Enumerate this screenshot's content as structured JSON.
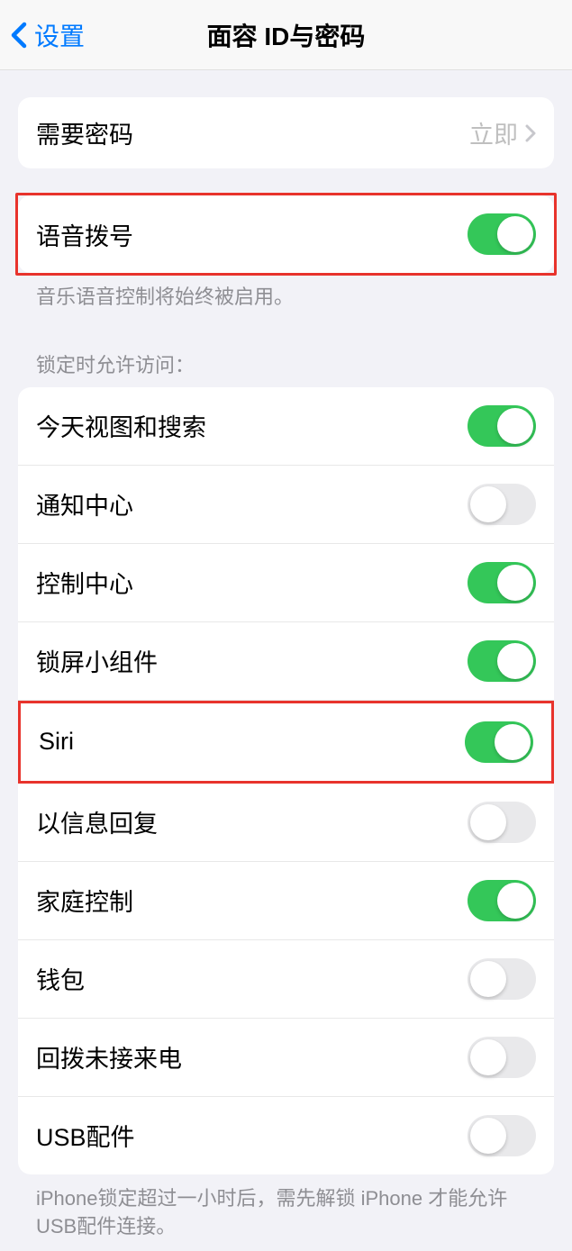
{
  "header": {
    "back_label": "设置",
    "title": "面容 ID与密码"
  },
  "passcode_row": {
    "label": "需要密码",
    "value": "立即"
  },
  "voice_dial": {
    "label": "语音拨号",
    "on": true,
    "footer": "音乐语音控制将始终被启用。"
  },
  "locked_access": {
    "header": "锁定时允许访问：",
    "items": [
      {
        "key": "today-search",
        "label": "今天视图和搜索",
        "on": true
      },
      {
        "key": "notification-center",
        "label": "通知中心",
        "on": false
      },
      {
        "key": "control-center",
        "label": "控制中心",
        "on": true
      },
      {
        "key": "lock-widgets",
        "label": "锁屏小组件",
        "on": true
      },
      {
        "key": "siri",
        "label": "Siri",
        "on": true
      },
      {
        "key": "reply-message",
        "label": "以信息回复",
        "on": false
      },
      {
        "key": "home-control",
        "label": "家庭控制",
        "on": true
      },
      {
        "key": "wallet",
        "label": "钱包",
        "on": false
      },
      {
        "key": "return-missed",
        "label": "回拨未接来电",
        "on": false
      },
      {
        "key": "usb-accessories",
        "label": "USB配件",
        "on": false
      }
    ],
    "footer": "iPhone锁定超过一小时后，需先解锁 iPhone 才能允许USB配件连接。"
  }
}
